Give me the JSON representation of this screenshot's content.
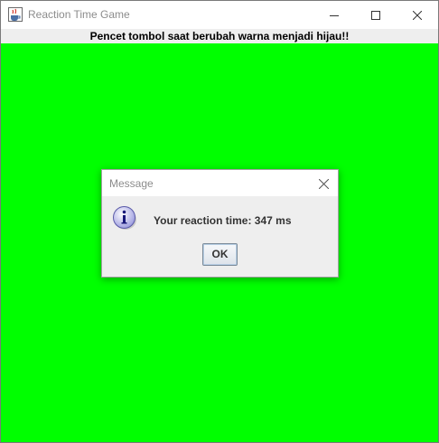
{
  "window": {
    "title": "Reaction Time Game",
    "icons": {
      "app": "java-cup-icon",
      "minimize": "minimize-icon",
      "maximize": "maximize-icon",
      "close": "close-icon"
    }
  },
  "header": {
    "instruction": "Pencet tombol saat berubah warna menjadi hijau!!"
  },
  "content": {
    "background_color": "#00ff00"
  },
  "dialog": {
    "title": "Message",
    "message": "Your reaction time: 347 ms",
    "ok_label": "OK",
    "icons": {
      "info": "info-icon",
      "close": "close-icon"
    }
  }
}
